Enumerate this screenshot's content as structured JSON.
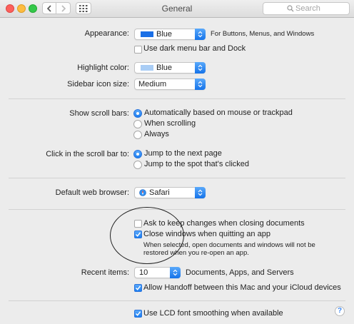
{
  "window": {
    "title": "General"
  },
  "search": {
    "placeholder": "Search"
  },
  "appearance": {
    "label": "Appearance:",
    "value": "Blue",
    "swatch_color": "#1a6fe6",
    "note": "For Buttons, Menus, and Windows",
    "dark_menu_label": "Use dark menu bar and Dock",
    "dark_menu_checked": false
  },
  "highlight": {
    "label": "Highlight color:",
    "value": "Blue",
    "swatch_color": "#a9cdf5"
  },
  "sidebar_icon": {
    "label": "Sidebar icon size:",
    "value": "Medium"
  },
  "scroll_bars": {
    "label": "Show scroll bars:",
    "options": [
      {
        "label": "Automatically based on mouse or trackpad",
        "selected": true
      },
      {
        "label": "When scrolling",
        "selected": false
      },
      {
        "label": "Always",
        "selected": false
      }
    ]
  },
  "scroll_click": {
    "label": "Click in the scroll bar to:",
    "options": [
      {
        "label": "Jump to the next page",
        "selected": true
      },
      {
        "label": "Jump to the spot that's clicked",
        "selected": false
      }
    ]
  },
  "browser": {
    "label": "Default web browser:",
    "value": "Safari"
  },
  "documents": {
    "ask_keep_label": "Ask to keep changes when closing documents",
    "ask_keep_checked": false,
    "close_windows_label": "Close windows when quitting an app",
    "close_windows_checked": true,
    "close_windows_note_line1": "When selected, open documents and windows will not be",
    "close_windows_note_line2": "restored when you re-open an app."
  },
  "recent": {
    "label": "Recent items:",
    "value": "10",
    "suffix": "Documents, Apps, and Servers",
    "handoff_label": "Allow Handoff between this Mac and your iCloud devices",
    "handoff_checked": true
  },
  "lcd": {
    "label": "Use LCD font smoothing when available",
    "checked": true
  },
  "help": {
    "label": "?"
  },
  "colors": {
    "accent": "#1c7ef0"
  }
}
